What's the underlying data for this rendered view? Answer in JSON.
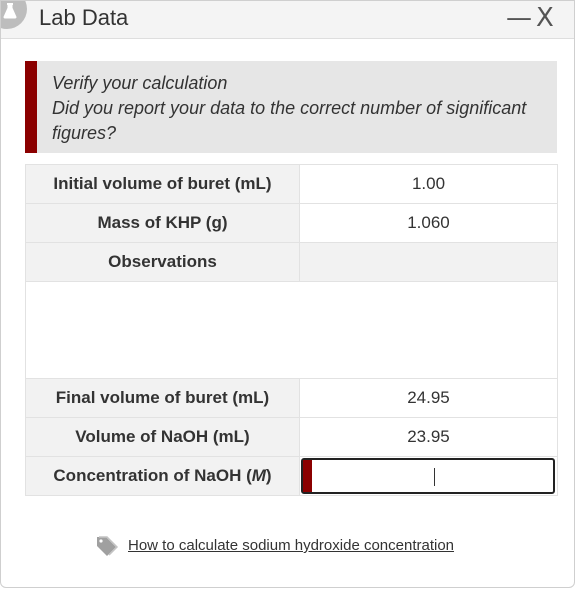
{
  "window": {
    "title": "Lab Data",
    "icon": "flask-icon",
    "minimize_glyph": "—",
    "close_glyph": "X"
  },
  "alert": {
    "line1": "Verify your calculation",
    "line2": "Did you report your data to the correct number of significant figures?",
    "accent_color": "#8b0000"
  },
  "table": {
    "initial_volume_label": "Initial volume of buret (mL)",
    "initial_volume_value": "1.00",
    "mass_khp_label": "Mass of KHP (g)",
    "mass_khp_value": "1.060",
    "observations_label": "Observations",
    "observations_value": "",
    "final_volume_label": "Final volume of buret (mL)",
    "final_volume_value": "24.95",
    "volume_naoh_label": "Volume of NaOH (mL)",
    "volume_naoh_value": "23.95",
    "concentration_label_prefix": "Concentration of NaOH (",
    "concentration_label_unit": "M",
    "concentration_label_suffix": ")",
    "concentration_value": ""
  },
  "help_link": {
    "icon": "tag-icon",
    "text": "How to calculate sodium hydroxide concentration"
  }
}
